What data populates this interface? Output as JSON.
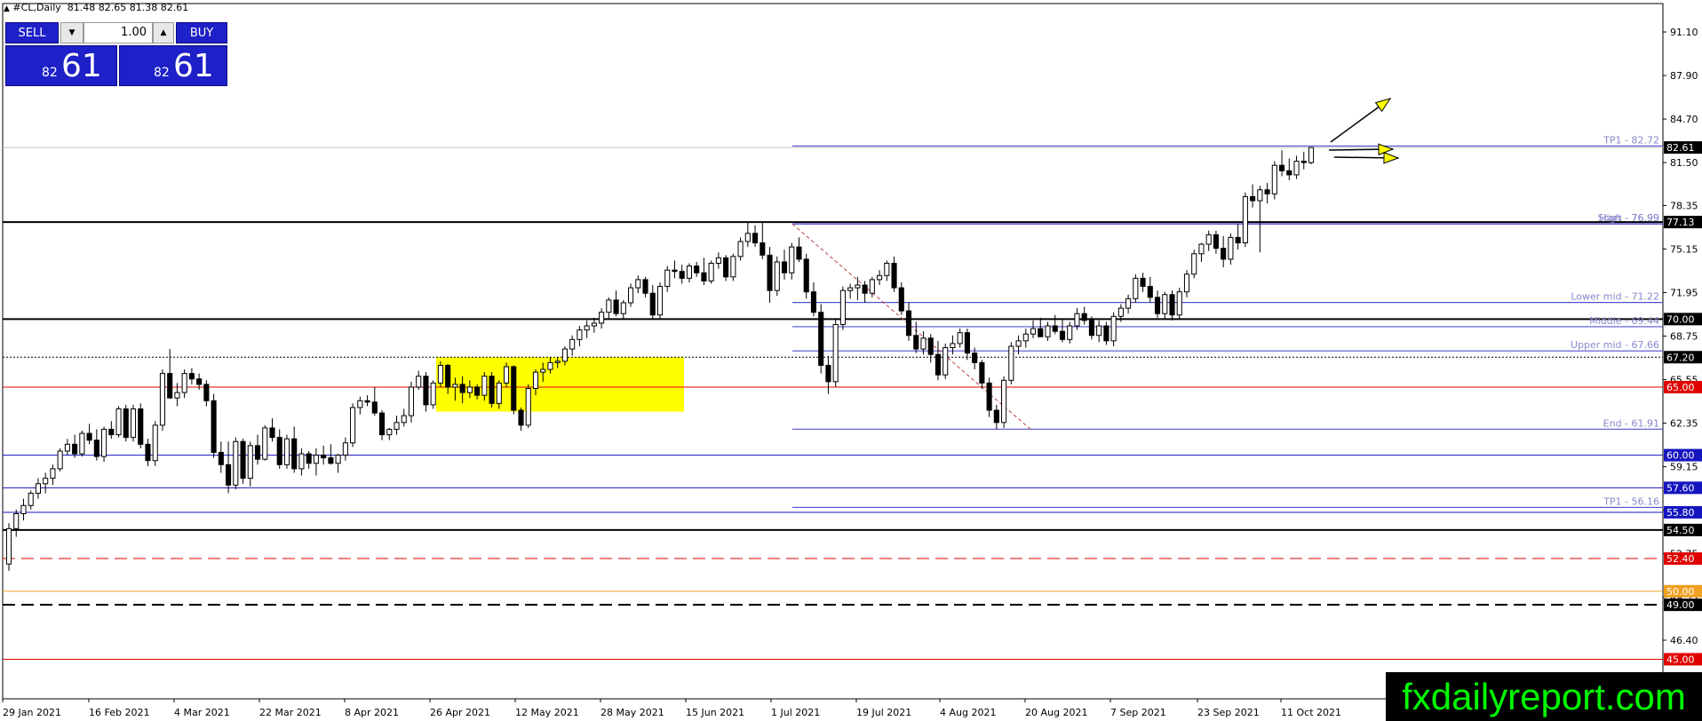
{
  "header": {
    "symbol": "#CL,Daily",
    "ohlc": "81.48 82.65 81.38 82.61"
  },
  "trade_panel": {
    "sell_label": "SELL",
    "buy_label": "BUY",
    "lot": "1.00",
    "sell_big": "82",
    "sell_small": "61",
    "buy_big": "82",
    "buy_small": "61",
    "color": "#1e20c8"
  },
  "watermark": "fxdailyreport.com",
  "chart_data": {
    "type": "candlestick",
    "y_ticks": [
      "91.10",
      "87.90",
      "84.70",
      "81.50",
      "78.35",
      "75.15",
      "71.95",
      "68.75",
      "65.55",
      "62.35",
      "59.15",
      "55.95",
      "52.75",
      "49.55",
      "46.40"
    ],
    "x_ticks": [
      "29 Jan 2021",
      "16 Feb 2021",
      "4 Mar 2021",
      "22 Mar 2021",
      "8 Apr 2021",
      "26 Apr 2021",
      "12 May 2021",
      "28 May 2021",
      "15 Jun 2021",
      "1 Jul 2021",
      "19 Jul 2021",
      "4 Aug 2021",
      "20 Aug 2021",
      "7 Sep 2021",
      "23 Sep 2021",
      "11 Oct 2021"
    ],
    "current_price": "82.61",
    "horizontal_levels": [
      {
        "price": 77.13,
        "label": "77.13",
        "color": "#000000",
        "style": "solid",
        "width": 2,
        "bg": "#000000",
        "fg": "#ffffff"
      },
      {
        "price": 70.0,
        "label": "70.00",
        "color": "#000000",
        "style": "solid",
        "width": 2,
        "bg": "#000000",
        "fg": "#ffffff"
      },
      {
        "price": 67.2,
        "label": "67.20",
        "color": "#000000",
        "style": "dotted",
        "width": 1,
        "bg": "#000000",
        "fg": "#ffffff"
      },
      {
        "price": 65.0,
        "label": "65.00",
        "color": "#e00000",
        "style": "solid",
        "width": 1,
        "bg": "#e00000",
        "fg": "#ffffff"
      },
      {
        "price": 60.0,
        "label": "60.00",
        "color": "#1515c0",
        "style": "solid",
        "width": 1,
        "bg": "#1515c0",
        "fg": "#ffffff"
      },
      {
        "price": 57.6,
        "label": "57.60",
        "color": "#1515c0",
        "style": "solid",
        "width": 1,
        "bg": "#1515c0",
        "fg": "#ffffff"
      },
      {
        "price": 55.8,
        "label": "55.80",
        "color": "#1515c0",
        "style": "solid",
        "width": 1,
        "bg": "#1515c0",
        "fg": "#ffffff"
      },
      {
        "price": 54.5,
        "label": "54.50",
        "color": "#000000",
        "style": "solid",
        "width": 2,
        "bg": "#000000",
        "fg": "#ffffff"
      },
      {
        "price": 52.4,
        "label": "52.40",
        "color": "#e00000",
        "style": "dashed",
        "width": 1,
        "bg": "#e00000",
        "fg": "#ffffff"
      },
      {
        "price": 50.0,
        "label": "50.00",
        "color": "#f0a020",
        "style": "solid",
        "width": 1,
        "bg": "#f0a020",
        "fg": "#ffffff"
      },
      {
        "price": 49.0,
        "label": "49.00",
        "color": "#000000",
        "style": "dashed",
        "width": 2,
        "bg": "#000000",
        "fg": "#ffffff"
      },
      {
        "price": 45.0,
        "label": "45.00",
        "color": "#e00000",
        "style": "solid",
        "width": 1,
        "bg": "#e00000",
        "fg": "#ffffff"
      }
    ],
    "fib_levels": [
      {
        "price": 82.72,
        "label": "TP1 - 82.72"
      },
      {
        "price": 76.99,
        "label": "Start - 76.99"
      },
      {
        "price": 77.0,
        "label": "High - 76.99"
      },
      {
        "price": 71.22,
        "label": "Lower mid - 71.22"
      },
      {
        "price": 69.44,
        "label": "Middle - 69.44"
      },
      {
        "price": 67.66,
        "label": "Upper mid - 67.66"
      },
      {
        "price": 61.91,
        "label": "End - 61.91"
      },
      {
        "price": 56.16,
        "label": "TP1 - 56.16"
      }
    ],
    "fib_color": "#5050d0",
    "fib_text_color": "#8888cc",
    "yellow_zone": {
      "top": 67.2,
      "bottom": 63.2,
      "color": "#ffff00"
    },
    "diagonal": {
      "from_price": 76.99,
      "to_price": 61.91,
      "color": "#c04040"
    },
    "candles": [
      [
        52.0,
        55.0,
        51.5,
        54.6
      ],
      [
        54.6,
        56.0,
        54.0,
        55.7
      ],
      [
        55.7,
        56.8,
        55.2,
        56.3
      ],
      [
        56.3,
        57.4,
        56.0,
        57.2
      ],
      [
        57.2,
        58.3,
        56.8,
        57.9
      ],
      [
        57.9,
        58.7,
        57.2,
        58.3
      ],
      [
        58.3,
        59.3,
        57.8,
        59.0
      ],
      [
        59.0,
        60.5,
        58.8,
        60.3
      ],
      [
        60.3,
        61.2,
        60.0,
        60.8
      ],
      [
        60.8,
        61.5,
        59.8,
        60.1
      ],
      [
        60.1,
        61.8,
        59.9,
        61.6
      ],
      [
        61.6,
        62.3,
        60.8,
        61.1
      ],
      [
        61.1,
        61.9,
        59.6,
        59.9
      ],
      [
        59.9,
        62.1,
        59.5,
        61.9
      ],
      [
        61.9,
        62.5,
        61.2,
        61.5
      ],
      [
        61.5,
        63.6,
        61.3,
        63.4
      ],
      [
        63.4,
        63.7,
        61.0,
        61.3
      ],
      [
        61.3,
        63.7,
        61.0,
        63.4
      ],
      [
        63.4,
        63.8,
        60.5,
        60.8
      ],
      [
        60.8,
        61.2,
        59.2,
        59.6
      ],
      [
        59.6,
        62.5,
        59.2,
        62.2
      ],
      [
        62.2,
        66.3,
        61.8,
        66.0
      ],
      [
        66.0,
        67.8,
        65.5,
        64.2
      ],
      [
        64.2,
        65.3,
        63.6,
        64.6
      ],
      [
        64.6,
        66.3,
        64.2,
        66.0
      ],
      [
        66.0,
        66.4,
        65.2,
        65.6
      ],
      [
        65.6,
        66.0,
        64.8,
        65.2
      ],
      [
        65.2,
        65.5,
        63.6,
        64.0
      ],
      [
        64.0,
        64.5,
        59.8,
        60.2
      ],
      [
        60.2,
        61.0,
        58.7,
        59.3
      ],
      [
        59.3,
        61.0,
        57.2,
        57.8
      ],
      [
        57.8,
        61.3,
        57.5,
        61.0
      ],
      [
        61.0,
        61.2,
        57.9,
        58.3
      ],
      [
        58.3,
        61.0,
        57.7,
        60.7
      ],
      [
        60.7,
        61.5,
        59.3,
        59.7
      ],
      [
        59.7,
        62.2,
        59.6,
        62.0
      ],
      [
        62.0,
        62.7,
        61.0,
        61.3
      ],
      [
        61.3,
        61.9,
        59.0,
        59.3
      ],
      [
        59.3,
        61.5,
        59.0,
        61.2
      ],
      [
        61.2,
        62.1,
        58.7,
        59.0
      ],
      [
        59.0,
        60.5,
        58.5,
        60.1
      ],
      [
        60.1,
        60.3,
        59.0,
        59.4
      ],
      [
        59.4,
        60.5,
        58.5,
        60.0
      ],
      [
        60.0,
        60.7,
        59.3,
        59.8
      ],
      [
        59.8,
        60.8,
        59.3,
        59.4
      ],
      [
        59.4,
        60.1,
        58.7,
        60.0
      ],
      [
        60.0,
        61.3,
        59.6,
        60.9
      ],
      [
        60.9,
        63.8,
        60.6,
        63.5
      ],
      [
        63.5,
        64.3,
        63.0,
        64.0
      ],
      [
        64.0,
        64.4,
        63.6,
        63.9
      ],
      [
        63.9,
        65.0,
        62.9,
        63.1
      ],
      [
        63.1,
        63.3,
        61.1,
        61.5
      ],
      [
        61.5,
        62.0,
        61.1,
        61.9
      ],
      [
        61.9,
        62.9,
        61.5,
        62.4
      ],
      [
        62.4,
        63.4,
        62.1,
        62.9
      ],
      [
        62.9,
        65.4,
        62.4,
        65.0
      ],
      [
        65.0,
        66.2,
        64.8,
        65.8
      ],
      [
        65.8,
        66.1,
        63.2,
        63.7
      ],
      [
        63.7,
        65.5,
        63.4,
        65.3
      ],
      [
        65.3,
        66.9,
        65.0,
        66.6
      ],
      [
        66.6,
        66.7,
        64.5,
        65.0
      ],
      [
        65.0,
        65.7,
        64.0,
        65.2
      ],
      [
        65.2,
        65.8,
        63.8,
        64.6
      ],
      [
        64.6,
        65.5,
        64.2,
        65.0
      ],
      [
        65.0,
        65.2,
        64.1,
        64.4
      ],
      [
        64.4,
        66.1,
        64.0,
        65.8
      ],
      [
        65.8,
        66.1,
        63.5,
        63.8
      ],
      [
        63.8,
        65.5,
        63.4,
        65.3
      ],
      [
        65.3,
        66.8,
        65.0,
        66.5
      ],
      [
        66.5,
        66.6,
        63.0,
        63.3
      ],
      [
        63.3,
        63.5,
        61.8,
        62.2
      ],
      [
        62.2,
        65.2,
        62.0,
        64.9
      ],
      [
        64.9,
        66.3,
        64.4,
        66.1
      ],
      [
        66.1,
        66.8,
        65.4,
        66.3
      ],
      [
        66.3,
        67.2,
        66.0,
        66.8
      ],
      [
        66.8,
        67.2,
        66.4,
        66.9
      ],
      [
        66.9,
        68.0,
        66.6,
        67.8
      ],
      [
        67.8,
        68.8,
        67.3,
        68.5
      ],
      [
        68.5,
        69.5,
        68.0,
        69.2
      ],
      [
        69.2,
        69.9,
        68.6,
        69.5
      ],
      [
        69.5,
        70.1,
        69.0,
        69.7
      ],
      [
        69.7,
        70.8,
        69.3,
        70.5
      ],
      [
        70.5,
        71.6,
        70.0,
        71.4
      ],
      [
        71.4,
        72.1,
        70.2,
        70.4
      ],
      [
        70.4,
        71.4,
        70.0,
        71.2
      ],
      [
        71.2,
        72.6,
        70.9,
        72.3
      ],
      [
        72.3,
        73.2,
        71.9,
        72.9
      ],
      [
        72.9,
        73.1,
        71.6,
        71.9
      ],
      [
        71.9,
        72.5,
        70.0,
        70.3
      ],
      [
        70.3,
        72.7,
        70.0,
        72.4
      ],
      [
        72.4,
        73.9,
        72.0,
        73.6
      ],
      [
        73.6,
        74.3,
        73.0,
        73.5
      ],
      [
        73.5,
        74.0,
        72.6,
        73.0
      ],
      [
        73.0,
        74.1,
        72.7,
        73.9
      ],
      [
        73.9,
        74.2,
        73.1,
        73.4
      ],
      [
        73.4,
        74.5,
        72.5,
        72.8
      ],
      [
        72.8,
        74.3,
        72.6,
        74.1
      ],
      [
        74.1,
        74.9,
        73.7,
        74.5
      ],
      [
        74.5,
        74.7,
        72.8,
        73.1
      ],
      [
        73.1,
        74.8,
        72.8,
        74.6
      ],
      [
        74.6,
        76.0,
        74.3,
        75.7
      ],
      [
        75.7,
        77.1,
        75.3,
        76.3
      ],
      [
        76.3,
        76.9,
        75.3,
        75.6
      ],
      [
        75.6,
        77.2,
        74.4,
        74.7
      ],
      [
        74.7,
        75.3,
        71.2,
        72.1
      ],
      [
        72.1,
        74.6,
        71.7,
        74.2
      ],
      [
        74.2,
        75.1,
        72.9,
        73.4
      ],
      [
        73.4,
        75.6,
        72.9,
        75.3
      ],
      [
        75.3,
        76.0,
        74.2,
        74.4
      ],
      [
        74.4,
        74.8,
        71.5,
        72.0
      ],
      [
        72.0,
        72.7,
        70.2,
        70.5
      ],
      [
        70.5,
        71.1,
        66.0,
        66.6
      ],
      [
        66.6,
        67.3,
        64.5,
        65.4
      ],
      [
        65.4,
        70.0,
        65.0,
        69.6
      ],
      [
        69.6,
        72.4,
        69.2,
        72.1
      ],
      [
        72.1,
        72.6,
        71.5,
        72.3
      ],
      [
        72.3,
        73.1,
        71.4,
        72.5
      ],
      [
        72.5,
        72.8,
        71.2,
        71.9
      ],
      [
        71.9,
        73.1,
        71.6,
        72.9
      ],
      [
        72.9,
        73.6,
        72.5,
        73.2
      ],
      [
        73.2,
        74.3,
        72.8,
        74.1
      ],
      [
        74.1,
        74.6,
        72.0,
        72.3
      ],
      [
        72.3,
        72.7,
        70.3,
        70.6
      ],
      [
        70.6,
        71.2,
        68.4,
        68.8
      ],
      [
        68.8,
        69.8,
        67.5,
        67.8
      ],
      [
        67.8,
        69.1,
        67.4,
        68.6
      ],
      [
        68.6,
        68.9,
        66.8,
        67.4
      ],
      [
        67.4,
        68.4,
        65.5,
        65.9
      ],
      [
        65.9,
        68.2,
        65.6,
        67.9
      ],
      [
        67.9,
        68.8,
        67.4,
        68.2
      ],
      [
        68.2,
        69.3,
        67.9,
        69.0
      ],
      [
        69.0,
        69.3,
        67.0,
        67.5
      ],
      [
        67.5,
        67.9,
        66.3,
        66.8
      ],
      [
        66.8,
        67.0,
        64.9,
        65.3
      ],
      [
        65.3,
        65.7,
        62.8,
        63.3
      ],
      [
        63.3,
        63.7,
        61.9,
        62.4
      ],
      [
        62.4,
        65.8,
        62.0,
        65.5
      ],
      [
        65.5,
        68.3,
        65.2,
        68.0
      ],
      [
        68.0,
        68.8,
        67.4,
        68.4
      ],
      [
        68.4,
        69.3,
        67.9,
        68.9
      ],
      [
        68.9,
        69.9,
        68.6,
        69.3
      ],
      [
        69.3,
        70.1,
        68.8,
        68.7
      ],
      [
        68.7,
        69.8,
        68.4,
        69.5
      ],
      [
        69.5,
        70.3,
        68.9,
        69.1
      ],
      [
        69.1,
        70.0,
        68.3,
        68.5
      ],
      [
        68.5,
        69.8,
        68.2,
        69.5
      ],
      [
        69.5,
        70.8,
        69.2,
        70.4
      ],
      [
        70.4,
        70.9,
        69.6,
        69.9
      ],
      [
        69.9,
        70.2,
        68.5,
        68.8
      ],
      [
        68.8,
        69.9,
        68.3,
        69.5
      ],
      [
        69.5,
        69.8,
        68.1,
        68.4
      ],
      [
        68.4,
        70.5,
        68.0,
        70.2
      ],
      [
        70.2,
        71.1,
        69.8,
        70.8
      ],
      [
        70.8,
        71.8,
        70.4,
        71.5
      ],
      [
        71.5,
        73.3,
        71.2,
        73.0
      ],
      [
        73.0,
        73.4,
        72.0,
        72.4
      ],
      [
        72.4,
        73.1,
        71.2,
        71.6
      ],
      [
        71.6,
        72.1,
        70.1,
        70.4
      ],
      [
        70.4,
        72.0,
        70.0,
        71.8
      ],
      [
        71.8,
        72.1,
        69.9,
        70.3
      ],
      [
        70.3,
        72.3,
        70.0,
        72.0
      ],
      [
        72.0,
        73.6,
        71.6,
        73.3
      ],
      [
        73.3,
        75.1,
        73.0,
        74.8
      ],
      [
        74.8,
        75.6,
        74.2,
        75.5
      ],
      [
        75.5,
        76.5,
        75.0,
        76.2
      ],
      [
        76.2,
        76.5,
        74.8,
        75.2
      ],
      [
        75.2,
        76.1,
        73.8,
        74.4
      ],
      [
        74.4,
        76.3,
        74.0,
        76.0
      ],
      [
        76.0,
        77.0,
        75.1,
        75.6
      ],
      [
        75.6,
        79.3,
        75.3,
        79.0
      ],
      [
        79.0,
        79.9,
        78.2,
        78.7
      ],
      [
        78.7,
        79.8,
        74.9,
        79.5
      ],
      [
        79.5,
        80.0,
        78.5,
        79.2
      ],
      [
        79.2,
        81.6,
        78.8,
        81.3
      ],
      [
        81.3,
        82.4,
        80.5,
        80.9
      ],
      [
        80.9,
        81.8,
        80.2,
        80.6
      ],
      [
        80.6,
        82.0,
        80.3,
        81.6
      ],
      [
        81.6,
        82.3,
        81.0,
        81.5
      ],
      [
        81.5,
        82.65,
        81.38,
        82.61
      ]
    ]
  }
}
